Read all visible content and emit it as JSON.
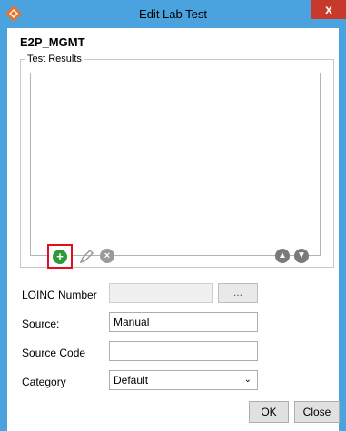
{
  "window": {
    "title": "Edit Lab Test",
    "close_glyph": "x"
  },
  "heading": "E2P_MGMT",
  "test_results": {
    "group_label": "Test Results",
    "icons": {
      "add": "add-icon",
      "edit": "pencil-icon",
      "delete": "delete-icon",
      "up": "arrow-up-icon",
      "down": "arrow-down-icon"
    }
  },
  "form": {
    "loinc": {
      "label": "LOINC Number",
      "value": "",
      "browse_label": "..."
    },
    "source": {
      "label": "Source:",
      "value": "Manual"
    },
    "source_code": {
      "label": "Source Code",
      "value": ""
    },
    "category": {
      "label": "Category",
      "value": "Default"
    }
  },
  "buttons": {
    "ok": "OK",
    "close": "Close"
  },
  "colors": {
    "titlebar": "#4aa3df",
    "close": "#c7392b",
    "add_highlight": "#e0101b",
    "add_green": "#2e9a3a"
  }
}
